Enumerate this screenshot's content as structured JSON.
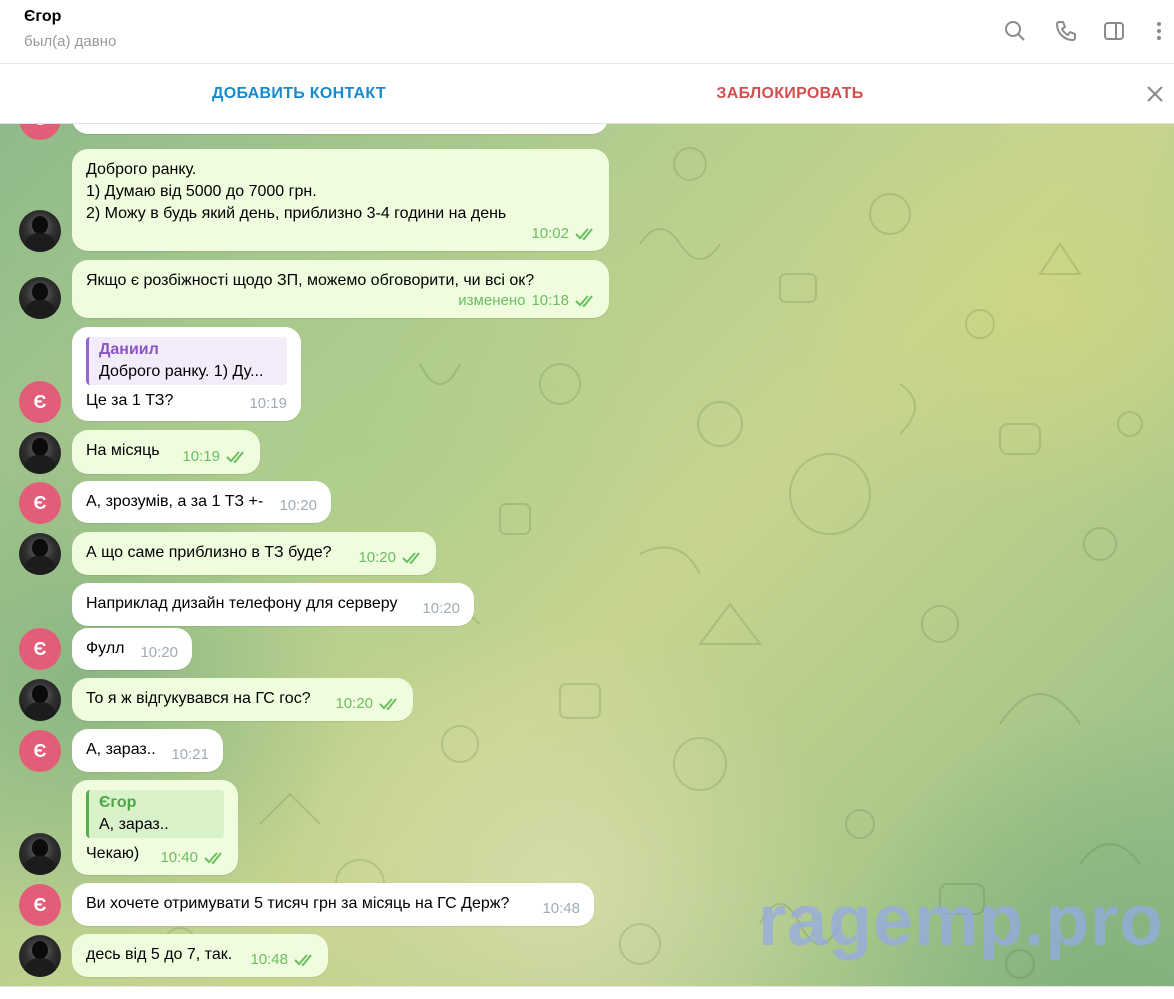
{
  "header": {
    "title": "Єгор",
    "status": "был(а) давно"
  },
  "actions": {
    "add_contact": "ДОБАВИТЬ КОНТАКТ",
    "block": "ЗАБЛОКИРОВАТЬ"
  },
  "icons": {
    "search": "search-icon",
    "call": "phone-icon",
    "sidebar": "sidebar-toggle-icon",
    "more": "more-vertical-icon",
    "close": "close-icon"
  },
  "colors": {
    "accent_blue": "#168acd",
    "danger_red": "#d14e4e",
    "outgoing_bubble": "#effdde",
    "avatar_pink": "#e25d78",
    "read_check": "#6cbe60"
  },
  "avatar_letter": "Є",
  "messages": [
    {
      "text": "Доброго ранку.\n1) Думаю від 5000 до 7000 грн.\n2) Можу в будь який день, приблизно 3-4 години на день",
      "time": "10:02"
    },
    {
      "text": "Якщо є розбіжності щодо ЗП, можемо обговорити, чи всі ок?",
      "time": "10:18",
      "edited": "изменено"
    },
    {
      "reply_name": "Даниил",
      "reply_text": "Доброго ранку.  1) Ду...",
      "text": "Це за 1 ТЗ?",
      "time": "10:19"
    },
    {
      "text": "На місяць",
      "time": "10:19"
    },
    {
      "text": "А, зрозумів, а за 1 ТЗ +-",
      "time": "10:20"
    },
    {
      "text": "А що саме приблизно в ТЗ буде?",
      "time": "10:20"
    },
    {
      "text": "Наприклад дизайн телефону для серверу",
      "time": "10:20"
    },
    {
      "text": "Фулл",
      "time": "10:20"
    },
    {
      "text": "То я ж відгукувався на ГС гос?",
      "time": "10:20"
    },
    {
      "text": "А, зараз..",
      "time": "10:21"
    },
    {
      "reply_name": "Єгор",
      "reply_text": "А, зараз..",
      "text": "Чекаю)",
      "time": "10:40"
    },
    {
      "text": "Ви хочете отримувати 5 тисяч грн за місяць на ГС Держ?",
      "time": "10:48"
    },
    {
      "text": "десь від 5 до 7, так.",
      "time": "10:48"
    }
  ],
  "watermark": "ragemp.pro"
}
